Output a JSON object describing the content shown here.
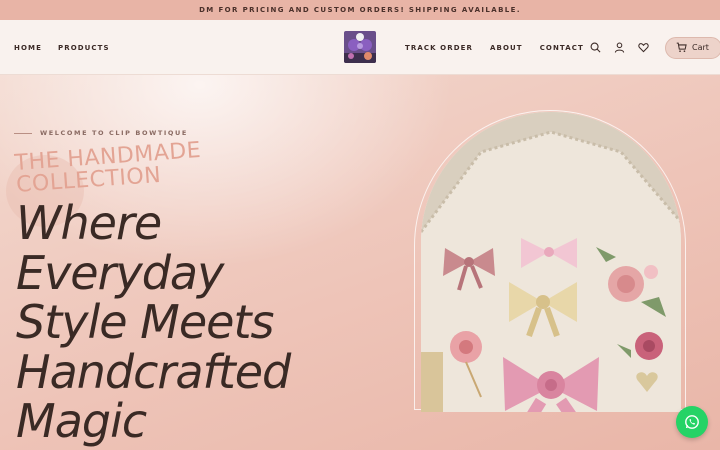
{
  "announcement": {
    "text": "DM FOR PRICING AND CUSTOM ORDERS! SHIPPING AVAILABLE."
  },
  "header": {
    "nav_left": [
      {
        "label": "HOME"
      },
      {
        "label": "PRODUCTS"
      }
    ],
    "nav_right": [
      {
        "label": "TRACK ORDER"
      },
      {
        "label": "ABOUT"
      },
      {
        "label": "CONTACT"
      }
    ],
    "icons": [
      "search-icon",
      "account-icon",
      "heart-icon",
      "cart-icon"
    ],
    "cart_label": "Cart"
  },
  "hero": {
    "eyebrow": "WELCOME TO CLIP BOWTIQUE",
    "subtitle_lines": [
      "THE HANDMADE",
      "COLLECTION"
    ],
    "headline_lines": [
      "Where",
      "Everyday",
      "Style Meets",
      "Handcrafted",
      "Magic"
    ]
  },
  "colors": {
    "announcement_bg": "#e8b4a6",
    "header_bg": "#f9f2ee",
    "accent_pink": "#e3a494",
    "text_dark": "#3a2a25",
    "whatsapp_green": "#25d366"
  }
}
